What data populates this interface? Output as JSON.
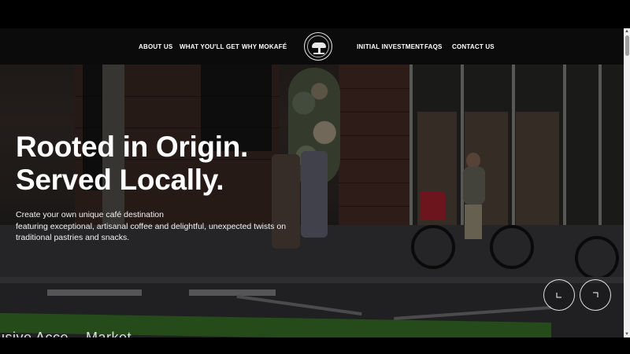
{
  "nav": {
    "left": [
      "ABOUT US",
      "WHAT YOU'LL GET",
      "WHY MOKAFÉ"
    ],
    "right": [
      "INITIAL INVESTMENT",
      "FAQS",
      "CONTACT US"
    ],
    "logo_icon": "tree-emblem-icon"
  },
  "hero": {
    "title_line1": "Rooted in Origin.",
    "title_line2": "Served Locally.",
    "subtitle_line1": "Create your own unique café destination",
    "subtitle_line2": "featuring exceptional, artisanal coffee and delightful, unexpected twists on",
    "subtitle_line3": "traditional pastries and snacks."
  },
  "slider": {
    "prev_icon": "arrow-prev-icon",
    "next_icon": "arrow-next-icon"
  },
  "next_section_peek": "usive Acce... Market",
  "colors": {
    "header_bg": "#0b0b0b",
    "text": "#ffffff",
    "green_band": "#3d7a2a"
  }
}
